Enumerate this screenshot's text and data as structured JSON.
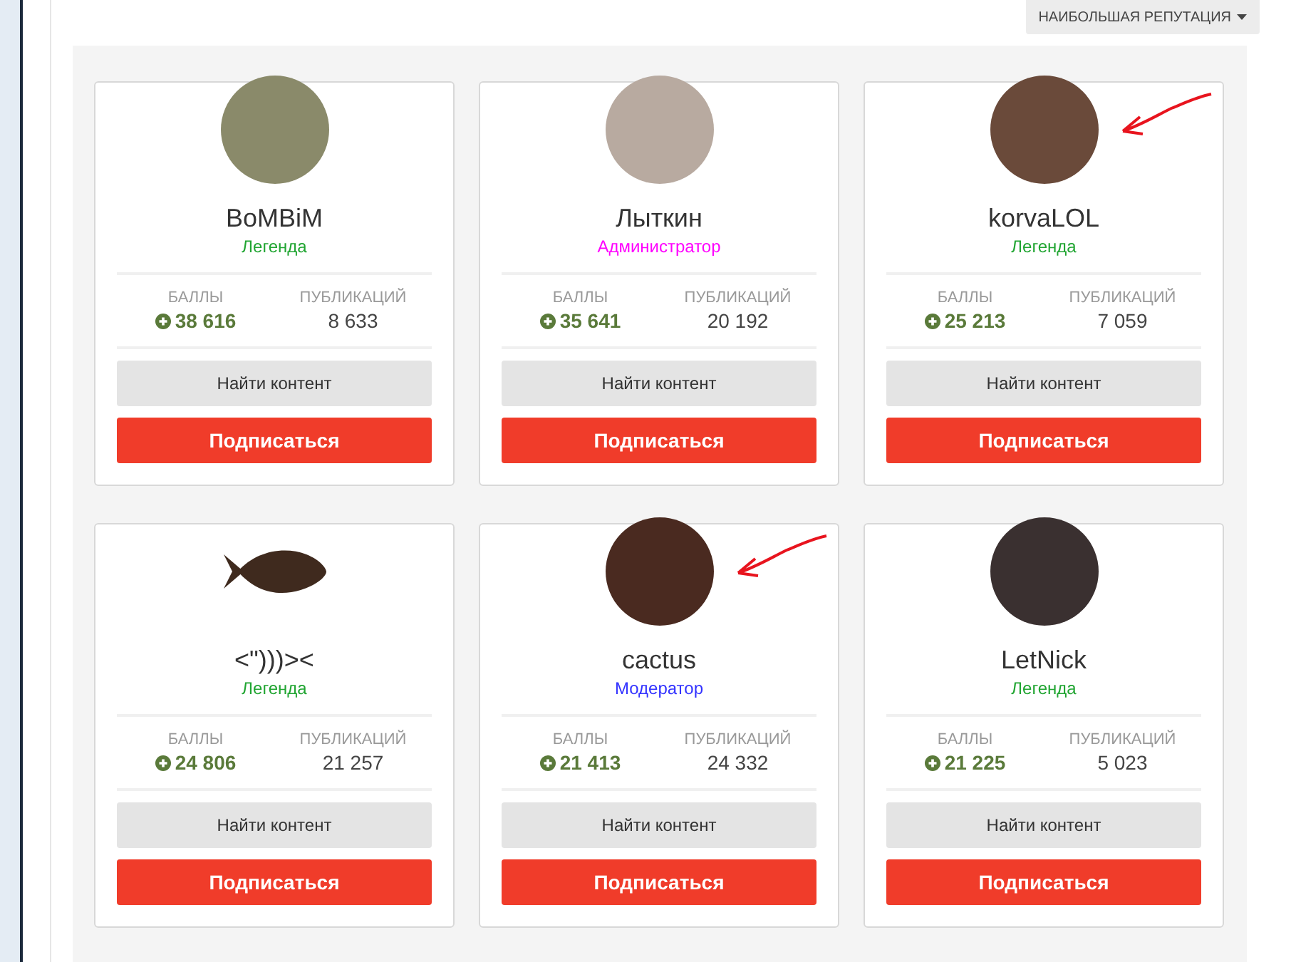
{
  "sort_button": {
    "label": "НАИБОЛЬШАЯ РЕПУТАЦИЯ"
  },
  "members": [
    {
      "name": "BoMBiM",
      "role": "Легенда",
      "color": "#21a532",
      "kind": "photo",
      "points_label": "БАЛЛЫ",
      "points": "38 616",
      "posts_label": "ПУБЛИКАЦИЙ",
      "posts": "8 633",
      "find_button": "Найти контент",
      "follow_button": "Подписаться",
      "marked": false
    },
    {
      "name": "Лыткин",
      "role": "Администратор",
      "color": "#ff00ff",
      "kind": "photo",
      "points_label": "БАЛЛЫ",
      "points": "35 641",
      "posts_label": "ПУБЛИКАЦИЙ",
      "posts": "20 192",
      "find_button": "Найти контент",
      "follow_button": "Подписаться",
      "marked": false
    },
    {
      "name": "korvaLOL",
      "role": "Легенда",
      "color": "#21a532",
      "kind": "photo",
      "points_label": "БАЛЛЫ",
      "points": "25 213",
      "posts_label": "ПУБЛИКАЦИЙ",
      "posts": "7 059",
      "find_button": "Найти контент",
      "follow_button": "Подписаться",
      "marked": true
    },
    {
      "name": "<\")))><",
      "role": "Легенда",
      "color": "#21a532",
      "kind": "fish",
      "points_label": "БАЛЛЫ",
      "points": "24 806",
      "posts_label": "ПУБЛИКАЦИЙ",
      "posts": "21 257",
      "find_button": "Найти контент",
      "follow_button": "Подписаться",
      "marked": false
    },
    {
      "name": "cactus",
      "role": "Модератор",
      "color": "#3333ff",
      "kind": "photo",
      "points_label": "БАЛЛЫ",
      "points": "21 413",
      "posts_label": "ПУБЛИКАЦИЙ",
      "posts": "24 332",
      "find_button": "Найти контент",
      "follow_button": "Подписаться",
      "marked": true
    },
    {
      "name": "LetNick",
      "role": "Легенда",
      "color": "#21a532",
      "kind": "photo",
      "points_label": "БАЛЛЫ",
      "points": "21 225",
      "posts_label": "ПУБЛИКАЦИЙ",
      "posts": "5 023",
      "find_button": "Найти контент",
      "follow_button": "Подписаться",
      "marked": false
    }
  ]
}
